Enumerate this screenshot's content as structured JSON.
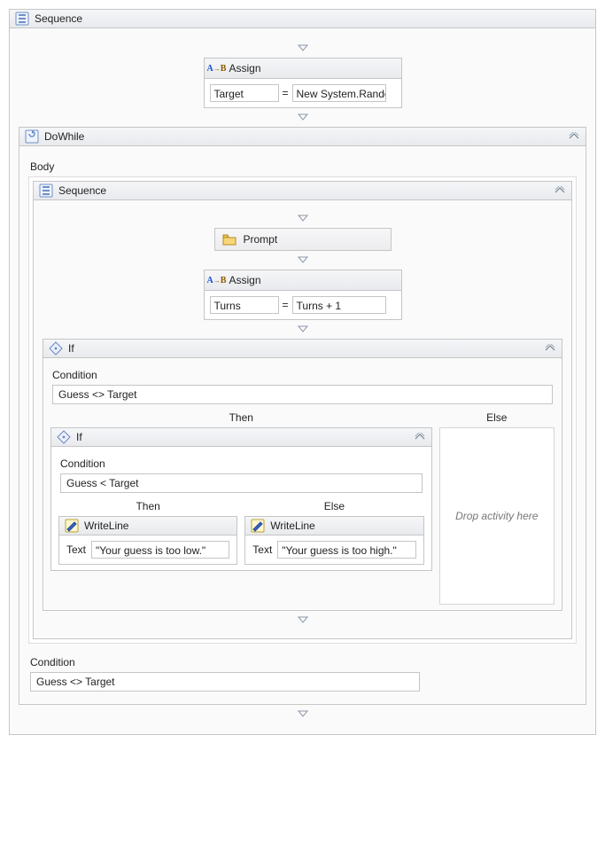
{
  "outer": {
    "title": "Sequence"
  },
  "assign1": {
    "title": "Assign",
    "target": "Target",
    "value": "New System.Randc"
  },
  "dowhile": {
    "title": "DoWhile",
    "body_label": "Body",
    "cond_label": "Condition",
    "condition": "Guess <> Target"
  },
  "innerSeq": {
    "title": "Sequence"
  },
  "prompt": {
    "label": "Prompt"
  },
  "assign2": {
    "title": "Assign",
    "target": "Turns",
    "value": "Turns + 1"
  },
  "if1": {
    "title": "If",
    "cond_label": "Condition",
    "condition": "Guess <> Target",
    "then_label": "Then",
    "else_label": "Else",
    "else_drop": "Drop activity here"
  },
  "if2": {
    "title": "If",
    "cond_label": "Condition",
    "condition": "Guess < Target",
    "then_label": "Then",
    "else_label": "Else"
  },
  "wl_low": {
    "title": "WriteLine",
    "text_label": "Text",
    "text": "\"Your guess is too low.\""
  },
  "wl_high": {
    "title": "WriteLine",
    "text_label": "Text",
    "text": "\"Your guess is too high.\""
  },
  "eq": "="
}
